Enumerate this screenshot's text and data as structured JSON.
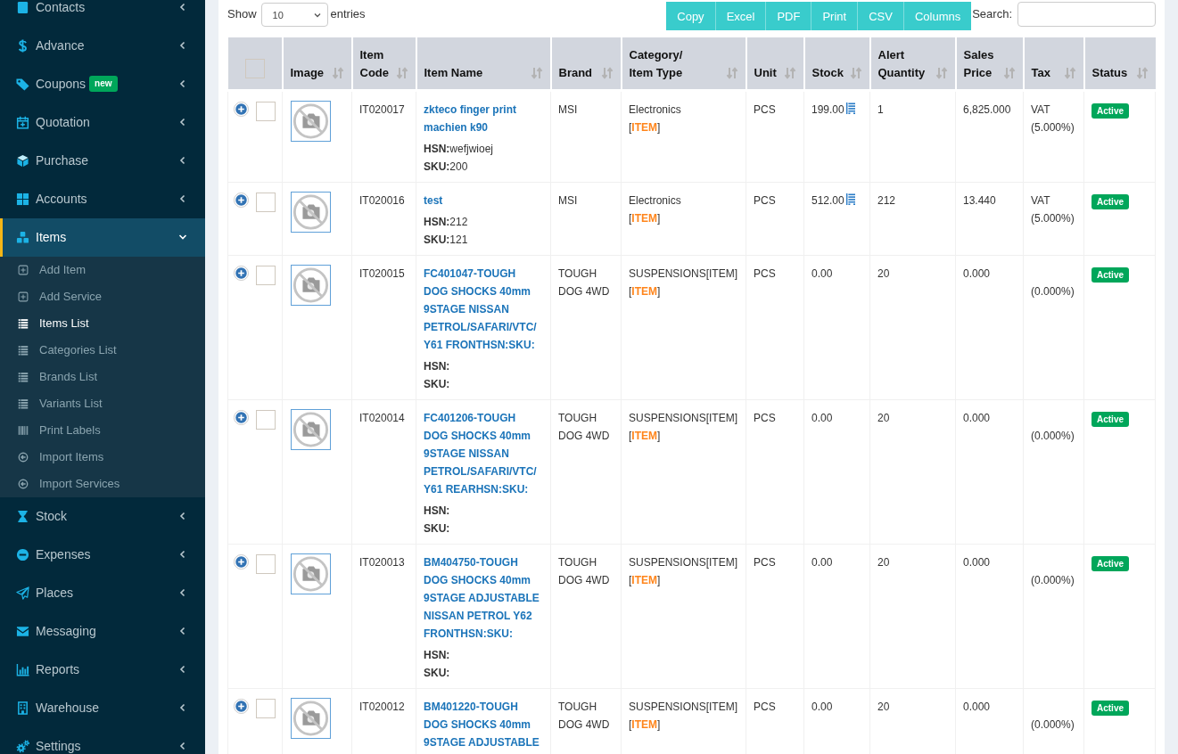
{
  "sidebar": {
    "items": [
      {
        "label": "Contacts",
        "expanded": false,
        "selected": false
      },
      {
        "label": "Advance",
        "expanded": false,
        "selected": false
      },
      {
        "label": "Coupons",
        "badge": "new",
        "expanded": false,
        "selected": false
      },
      {
        "label": "Quotation",
        "expanded": false,
        "selected": false
      },
      {
        "label": "Purchase",
        "expanded": false,
        "selected": false
      },
      {
        "label": "Accounts",
        "expanded": false,
        "selected": false
      },
      {
        "label": "Items",
        "expanded": true,
        "selected": true,
        "children": [
          {
            "label": "Add Item",
            "selected": false
          },
          {
            "label": "Add Service",
            "selected": false
          },
          {
            "label": "Items List",
            "selected": true
          },
          {
            "label": "Categories List",
            "selected": false
          },
          {
            "label": "Brands List",
            "selected": false
          },
          {
            "label": "Variants List",
            "selected": false
          },
          {
            "label": "Print Labels",
            "selected": false
          },
          {
            "label": "Import Items",
            "selected": false
          },
          {
            "label": "Import Services",
            "selected": false
          }
        ]
      },
      {
        "label": "Stock",
        "expanded": false,
        "selected": false
      },
      {
        "label": "Expenses",
        "expanded": false,
        "selected": false
      },
      {
        "label": "Places",
        "expanded": false,
        "selected": false
      },
      {
        "label": "Messaging",
        "expanded": false,
        "selected": false
      },
      {
        "label": "Reports",
        "expanded": false,
        "selected": false
      },
      {
        "label": "Warehouse",
        "expanded": false,
        "selected": false
      },
      {
        "label": "Settings",
        "expanded": false,
        "selected": false
      }
    ]
  },
  "toolbar": {
    "show_label": "Show",
    "page_length": "10",
    "entries_label": "entries",
    "buttons": [
      "Copy",
      "Excel",
      "PDF",
      "Print",
      "CSV",
      "Columns"
    ],
    "search_label": "Search:"
  },
  "table": {
    "select_all": {
      "checked": false
    },
    "columns": [
      "Image",
      "Item Code",
      "Item Name",
      "Brand",
      "Category/ Item Type",
      "Unit",
      "Stock",
      "Alert Quantity",
      "Sales Price",
      "Tax",
      "Status"
    ],
    "rows": [
      {
        "expanded": false,
        "selected": false,
        "item_code": "IT020017",
        "name": "zkteco finger print machien k90",
        "hsn_label": "HSN:",
        "hsn": "wefjwioej",
        "sku_label": "SKU:",
        "sku": "200",
        "brand": "MSI",
        "category": "Electronics",
        "item_type": "[**ITEM**]",
        "unit": "PCS",
        "stock": "199.00",
        "stock_icon": true,
        "alert_quantity": "1",
        "sales_price": "6,825.000",
        "tax_name": "VAT",
        "tax_rate": "(5.000%)",
        "status": "Active"
      },
      {
        "expanded": false,
        "selected": false,
        "item_code": "IT020016",
        "name": "test",
        "hsn_label": "HSN:",
        "hsn": "212",
        "sku_label": "SKU:",
        "sku": "121",
        "brand": "MSI",
        "category": "Electronics",
        "item_type": "[**ITEM**]",
        "unit": "PCS",
        "stock": "512.00",
        "stock_icon": true,
        "alert_quantity": "212",
        "sales_price": "13.440",
        "tax_name": "VAT",
        "tax_rate": "(5.000%)",
        "status": "Active"
      },
      {
        "expanded": false,
        "selected": false,
        "item_code": "IT020015",
        "name": "FC401047-TOUGH DOG SHOCKS 40mm 9STAGE NISSAN PETROL/SAFARI/VTC/Y61 FRONTHSN:SKU:",
        "hsn_label": "HSN:",
        "sku_label": "SKU:",
        "brand": "TOUGH DOG 4WD",
        "category": "SUSPENSIONS[ITEM]",
        "item_type": "[**ITEM**]",
        "unit": "PCS",
        "stock": "0.00",
        "stock_icon": false,
        "alert_quantity": "20",
        "sales_price": "0.000",
        "tax_rate": "(0.000%)",
        "status": "Active"
      },
      {
        "expanded": false,
        "selected": false,
        "item_code": "IT020014",
        "name": "FC401206-TOUGH DOG SHOCKS 40mm 9STAGE NISSAN PETROL/SAFARI/VTC/Y61 REARHSN:SKU:",
        "hsn_label": "HSN:",
        "sku_label": "SKU:",
        "brand": "TOUGH DOG 4WD",
        "category": "SUSPENSIONS[ITEM]",
        "item_type": "[**ITEM**]",
        "unit": "PCS",
        "stock": "0.00",
        "stock_icon": false,
        "alert_quantity": "20",
        "sales_price": "0.000",
        "tax_rate": "(0.000%)",
        "status": "Active"
      },
      {
        "expanded": false,
        "selected": false,
        "item_code": "IT020013",
        "name": "BM404750-TOUGH DOG SHOCKS 40mm 9STAGE ADJUSTABLE NISSAN PETROL Y62 FRONTHSN:SKU:",
        "hsn_label": "HSN:",
        "sku_label": "SKU:",
        "brand": "TOUGH DOG 4WD",
        "category": "SUSPENSIONS[ITEM]",
        "item_type": "[**ITEM**]",
        "unit": "PCS",
        "stock": "0.00",
        "stock_icon": false,
        "alert_quantity": "20",
        "sales_price": "0.000",
        "tax_rate": "(0.000%)",
        "status": "Active"
      },
      {
        "expanded": false,
        "selected": false,
        "item_code": "IT020012",
        "name": "BM401220-TOUGH DOG SHOCKS 40mm 9STAGE ADJUSTABLE",
        "brand": "TOUGH DOG 4WD",
        "category": "SUSPENSIONS[ITEM]",
        "item_type": "[**ITEM**]",
        "unit": "PCS",
        "stock": "0.00",
        "stock_icon": false,
        "alert_quantity": "20",
        "sales_price": "0.000",
        "tax_rate": "(0.000%)",
        "status": "Active"
      }
    ]
  }
}
